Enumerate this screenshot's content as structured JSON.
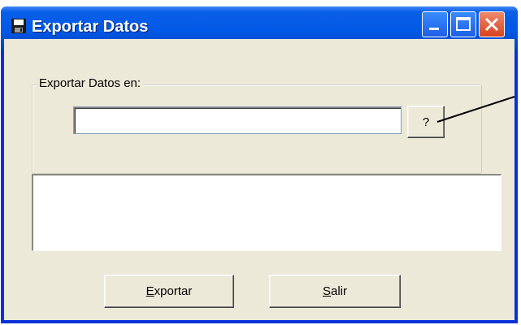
{
  "window": {
    "title": "Exportar Datos",
    "icon": "floppy-disk-icon"
  },
  "controls": {
    "minimize": "minimize-icon",
    "maximize": "maximize-icon",
    "close": "close-icon"
  },
  "group": {
    "legend": "Exportar Datos en:"
  },
  "path_input": {
    "value": "",
    "placeholder": ""
  },
  "help_button": {
    "label": "?"
  },
  "log": {
    "value": ""
  },
  "buttons": {
    "export": {
      "mnemonic": "E",
      "rest": "xportar"
    },
    "exit": {
      "mnemonic": "S",
      "rest": "alir"
    }
  },
  "colors": {
    "titlebar": "#0058e6",
    "client": "#ece9d8",
    "close": "#d8421f"
  }
}
